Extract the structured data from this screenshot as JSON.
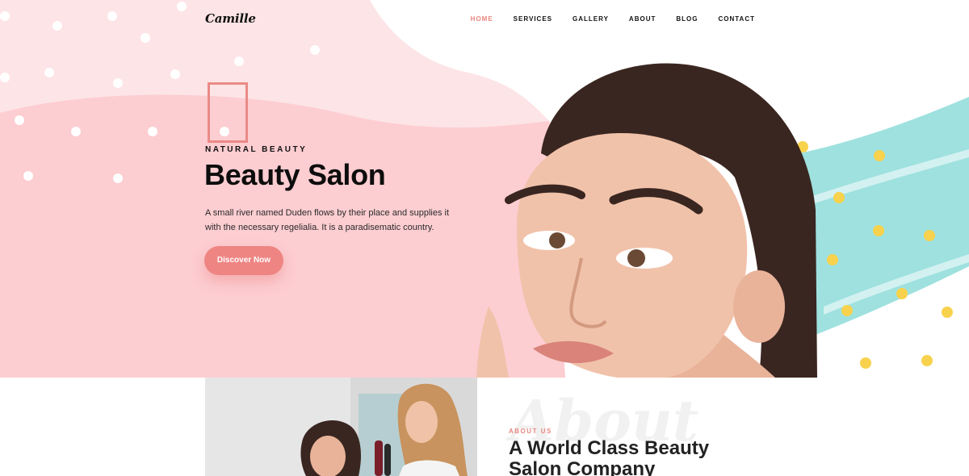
{
  "header": {
    "logo": "Camille",
    "nav": [
      {
        "label": "HOME",
        "active": true
      },
      {
        "label": "SERVICES",
        "active": false
      },
      {
        "label": "GALLERY",
        "active": false
      },
      {
        "label": "ABOUT",
        "active": false
      },
      {
        "label": "BLOG",
        "active": false
      },
      {
        "label": "CONTACT",
        "active": false
      }
    ]
  },
  "hero": {
    "eyebrow": "NATURAL BEAUTY",
    "title": "Beauty Salon",
    "text": "A small river named Duden flows by their place and supplies it with the necessary regelialia. It is a paradisematic country.",
    "button_label": "Discover Now"
  },
  "about": {
    "watermark": "About",
    "eyebrow": "ABOUT US",
    "title": "A World Class Beauty Salon Company"
  },
  "colors": {
    "accent": "#ee8583",
    "hero_pink": "#fccdd1",
    "hero_pink_light": "#fde4e6",
    "teal": "#9ee1df",
    "dot_yellow": "#f8d24c"
  }
}
